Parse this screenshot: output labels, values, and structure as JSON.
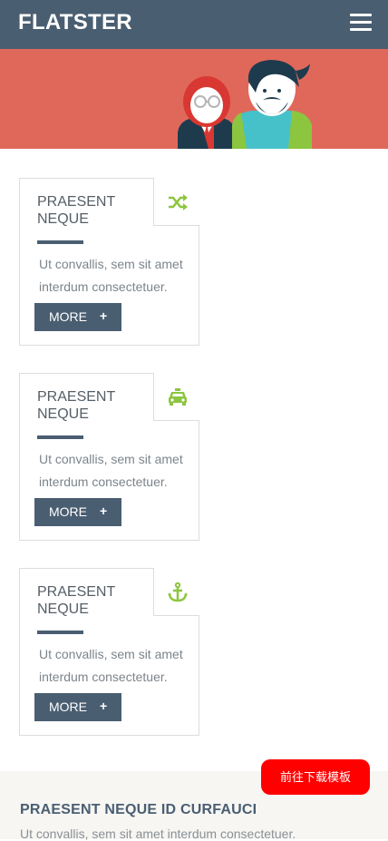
{
  "header": {
    "brand": "FLATSTER",
    "menu_icon": "hamburger-menu-icon"
  },
  "colors": {
    "header_bg": "#4a5e72",
    "hero_bg": "#e0685b",
    "accent_green": "#8cc63f",
    "download_bg": "#ff0000",
    "footer_bg": "#f7f6f3"
  },
  "features": [
    {
      "title": "PRAESENT NEQUE",
      "icon": "shuffle-icon",
      "text": "Ut convallis, sem sit amet interdum consectetuer.",
      "button": "MORE",
      "button_icon": "+"
    },
    {
      "title": "PRAESENT NEQUE",
      "icon": "taxi-icon",
      "text": "Ut convallis, sem sit amet interdum consectetuer.",
      "button": "MORE",
      "button_icon": "+"
    },
    {
      "title": "PRAESENT NEQUE",
      "icon": "anchor-icon",
      "text": "Ut convallis, sem sit amet interdum consectetuer.",
      "button": "MORE",
      "button_icon": "+"
    }
  ],
  "section": {
    "title": "PRAESENT NEQUE ID CURFAUCI",
    "text": "Ut convallis, sem sit amet interdum consectetuer."
  },
  "download_button": "前往下载模板"
}
